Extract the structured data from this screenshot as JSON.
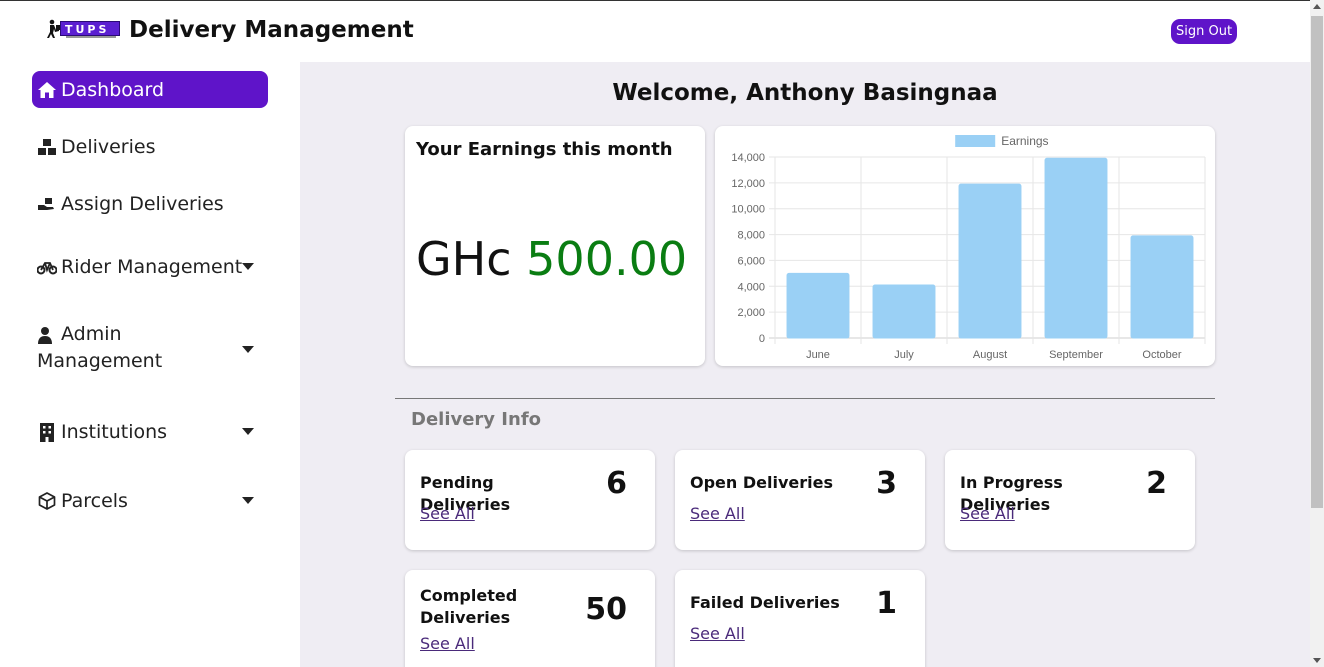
{
  "header": {
    "logo_text": "TUPS",
    "title": "Delivery Management",
    "signout_label": "Sign Out"
  },
  "sidebar": {
    "items": [
      {
        "label": "Dashboard",
        "icon": "home-icon",
        "active": true
      },
      {
        "label": "Deliveries",
        "icon": "boxes-icon"
      },
      {
        "label": "Assign Deliveries",
        "icon": "hand-box-icon"
      },
      {
        "label": "Rider Management",
        "icon": "bicycle-icon",
        "dropdown": true
      },
      {
        "label": "Admin",
        "label2": "Management",
        "icon": "user-tie-icon",
        "dropdown": true
      },
      {
        "label": "Institutions",
        "icon": "building-icon",
        "dropdown": true
      },
      {
        "label": "Parcels",
        "icon": "cube-icon",
        "dropdown": true
      }
    ]
  },
  "main": {
    "welcome": "Welcome, Anthony Basingnaa",
    "earnings": {
      "title": "Your Earnings this month",
      "currency": "GHc",
      "amount": "500.00"
    },
    "section_title": "Delivery Info",
    "stats": [
      {
        "label": "Pending Deliveries",
        "count": "6",
        "link": "See All"
      },
      {
        "label": "Open Deliveries",
        "count": "3",
        "link": "See All"
      },
      {
        "label": "In Progress Deliveries",
        "count": "2",
        "link": "See All"
      },
      {
        "label": "Completed Deliveries",
        "count": "50",
        "link": "See All"
      },
      {
        "label": "Failed Deliveries",
        "count": "1",
        "link": "See All"
      }
    ]
  },
  "colors": {
    "accent": "#5f14c9",
    "amount_green": "#0a7d12",
    "bar_fill": "#9ad0f5",
    "bar_stroke": "#36a2eb"
  },
  "chart_data": {
    "type": "bar",
    "categories": [
      "June",
      "July",
      "August",
      "September",
      "October"
    ],
    "series": [
      {
        "name": "Earnings",
        "values": [
          5000,
          4100,
          11900,
          13900,
          7900
        ]
      }
    ],
    "ylim": [
      0,
      14000
    ],
    "yticks": [
      "0",
      "2,000",
      "4,000",
      "6,000",
      "8,000",
      "10,000",
      "12,000",
      "14,000"
    ],
    "grid": true,
    "legend": "top-center"
  }
}
